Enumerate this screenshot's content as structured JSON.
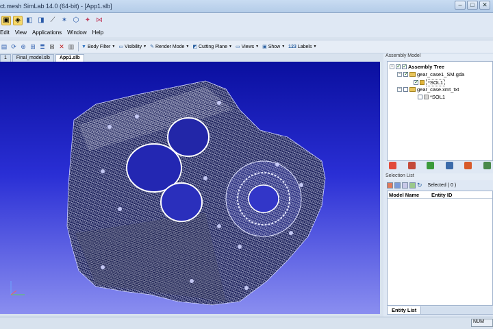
{
  "window": {
    "title": "ct.mesh SimLab 14.0 (64-bit) - [App1.slb]",
    "controls": [
      "–",
      "□",
      "✕"
    ]
  },
  "menu": [
    "Edit",
    "View",
    "Applications",
    "Window",
    "Help"
  ],
  "toolbar": {
    "body_filter": "Body Filter",
    "visibility": "Visibility",
    "render_mode": "Render Mode",
    "cutting_plane": "Cutting Plane",
    "views": "Views",
    "show": "Show",
    "labels": "Labels"
  },
  "doc_tabs": [
    {
      "label": "1",
      "active": false
    },
    {
      "label": "Final_model.slb",
      "active": false
    },
    {
      "label": "App1.slb",
      "active": true
    }
  ],
  "assembly": {
    "panel_title": "Assembly Model",
    "root": "Assembly Tree",
    "items": [
      {
        "label": "gear_case1_SM.gda",
        "checked": true,
        "child": "*SOL1",
        "child_checked": true
      },
      {
        "label": "gear_case.xmt_txt",
        "checked": false,
        "child": "*SOL1",
        "child_checked": false
      }
    ]
  },
  "selection": {
    "panel_title": "Selection List",
    "count_label": "Selected ( 0 )",
    "columns": [
      "Model Name",
      "Entity ID"
    ]
  },
  "bottom_tab": "Entity List",
  "status": {
    "right_text": "NUM"
  },
  "colors": {
    "viewport_top": "#0a0f9f",
    "viewport_bottom": "#8a8ef0",
    "mesh_line": "#e8ecff"
  }
}
